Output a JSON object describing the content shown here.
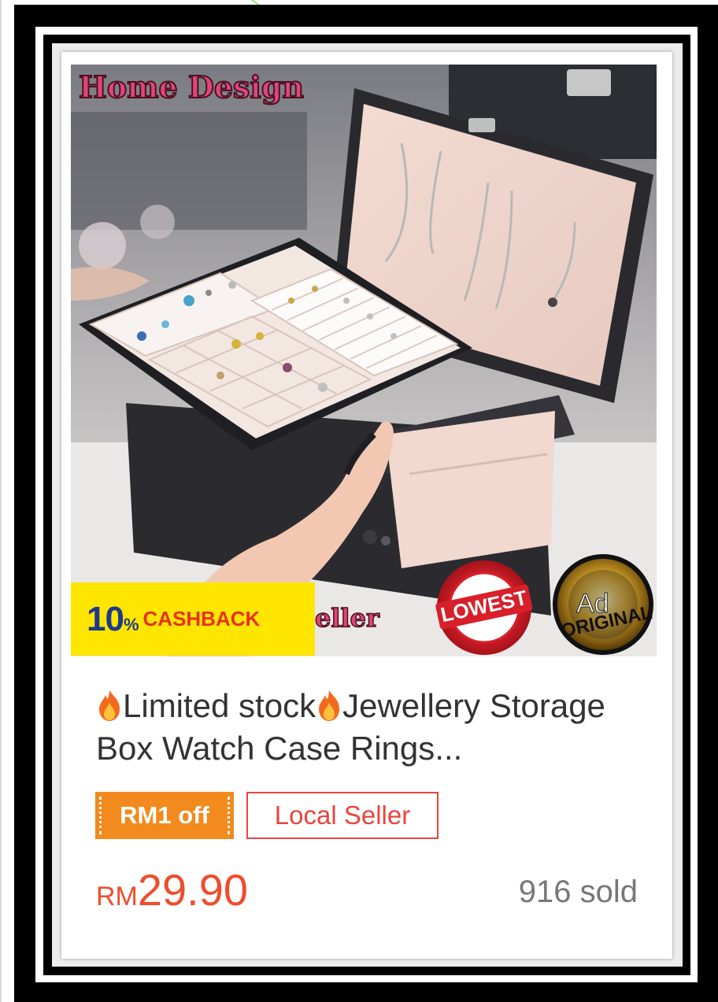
{
  "product": {
    "brand_tag": "Home Design",
    "seller_partial": "eller",
    "cashback": {
      "percent": "10",
      "percent_sign": "%",
      "label": "CASHBACK"
    },
    "badges": {
      "lowest_price": "LOWEST",
      "ad": "Ad",
      "original": "ORIGINAL"
    },
    "title_part1": "Limited stock",
    "title_part2": "Jewellery Storage Box Watch Case Rings...",
    "promo_label": "RM1 off",
    "seller_label": "Local Seller",
    "price_currency": "RM",
    "price_value": "29.90",
    "sold_text": "916 sold"
  },
  "colors": {
    "price": "#ee4d2d",
    "promo_bg": "#f28a1e",
    "seller_border": "#e8453c",
    "cashback_bg": "#ffe600",
    "frame": "#000000"
  }
}
